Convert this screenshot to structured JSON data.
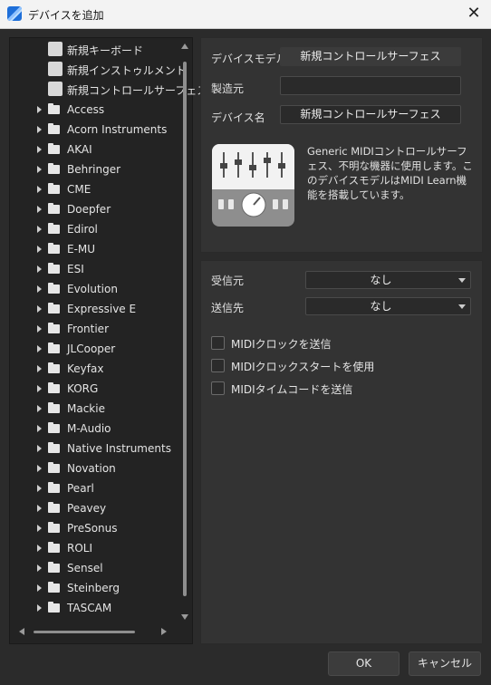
{
  "window": {
    "title": "デバイスを追加",
    "close": "✕"
  },
  "tree": {
    "special_items": [
      {
        "label": "新規キーボード",
        "icon": "piano-keyboard-icon"
      },
      {
        "label": "新規インストゥルメント",
        "icon": "music-note-icon"
      },
      {
        "label": "新規コントロールサーフェス",
        "icon": "fader-icon"
      }
    ],
    "manufacturers": [
      "Access",
      "Acorn Instruments",
      "AKAI",
      "Behringer",
      "CME",
      "Doepfer",
      "Edirol",
      "E-MU",
      "ESI",
      "Evolution",
      "Expressive E",
      "Frontier",
      "JLCooper",
      "Keyfax",
      "KORG",
      "Mackie",
      "M-Audio",
      "Native Instruments",
      "Novation",
      "Pearl",
      "Peavey",
      "PreSonus",
      "ROLI",
      "Sensel",
      "Steinberg",
      "TASCAM"
    ]
  },
  "device": {
    "model_label": "デバイスモデル",
    "model_value": "新規コントロールサーフェス",
    "manufacturer_label": "製造元",
    "manufacturer_value": "",
    "name_label": "デバイス名",
    "name_value": "新規コントロールサーフェス",
    "description": "Generic MIDIコントロールサーフェス、不明な機器に使用します。このデバイスモデルはMIDI Learn機能を搭載しています。"
  },
  "routing": {
    "receive_label": "受信元",
    "receive_value": "なし",
    "send_label": "送信先",
    "send_value": "なし"
  },
  "options": [
    {
      "label": "MIDIクロックを送信",
      "checked": false
    },
    {
      "label": "MIDIクロックスタートを使用",
      "checked": false
    },
    {
      "label": "MIDIタイムコードを送信",
      "checked": false
    }
  ],
  "buttons": {
    "ok": "OK",
    "cancel": "キャンセル"
  }
}
